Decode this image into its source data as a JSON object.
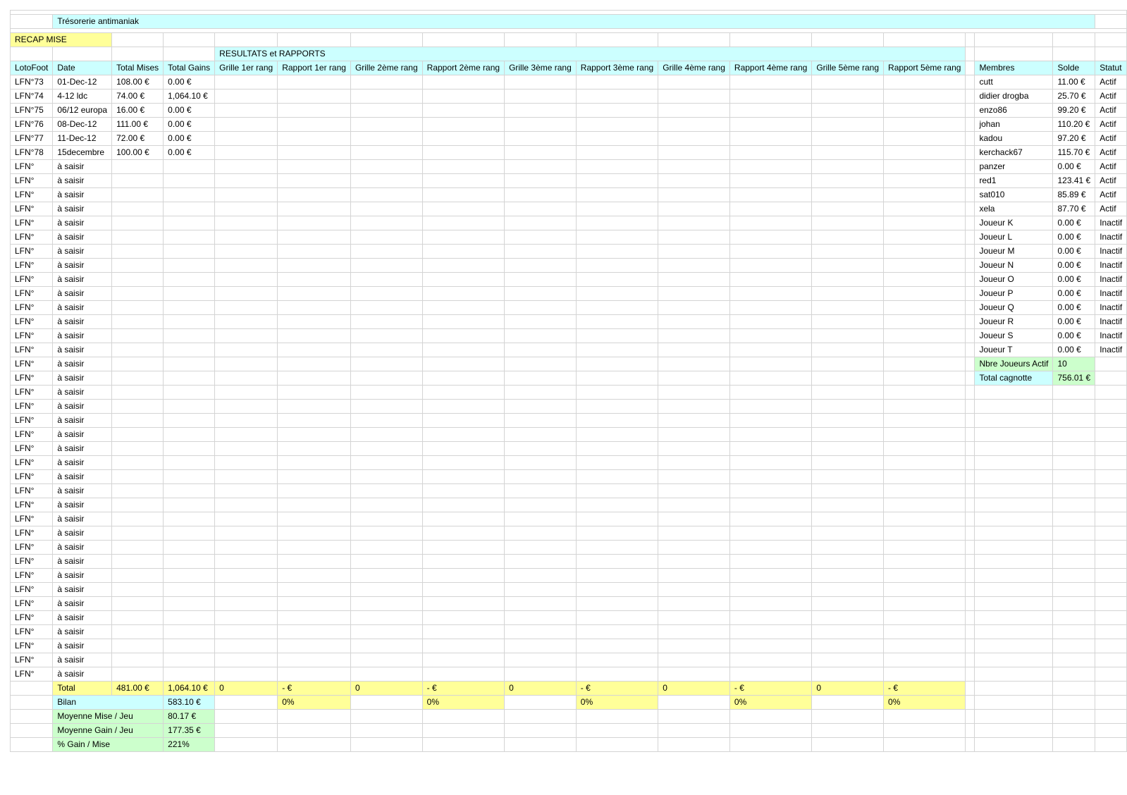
{
  "title": "Trésorerie antimaniak",
  "recap_label": "RECAP MISE",
  "results_label": "RESULTATS et RAPPORTS",
  "headers": [
    "LotoFoot",
    "Date",
    "Total Mises",
    "Total Gains",
    "Grille 1er rang",
    "Rapport 1er rang",
    "Grille 2ème rang",
    "Rapport 2ème rang",
    "Grille 3ème rang",
    "Rapport 3ème rang",
    "Grille 4ème rang",
    "Rapport 4ème rang",
    "Grille 5ème rang",
    "Rapport 5ème rang"
  ],
  "member_headers": [
    "Membres",
    "Solde",
    "Statut"
  ],
  "games": [
    {
      "id": "LFN°73",
      "date": "01-Dec-12",
      "mises": "108.00 €",
      "gains": "0.00 €"
    },
    {
      "id": "LFN°74",
      "date": "4-12 ldc",
      "mises": "74.00 €",
      "gains": "1,064.10 €"
    },
    {
      "id": "LFN°75",
      "date": "06/12 europa",
      "mises": "16.00 €",
      "gains": "0.00 €"
    },
    {
      "id": "LFN°76",
      "date": "08-Dec-12",
      "mises": "111.00 €",
      "gains": "0.00 €"
    },
    {
      "id": "LFN°77",
      "date": "11-Dec-12",
      "mises": "72.00 €",
      "gains": "0.00 €"
    },
    {
      "id": "LFN°78",
      "date": "15decembre",
      "mises": "100.00 €",
      "gains": "0.00 €"
    }
  ],
  "empty_game": {
    "id": "LFN°",
    "date": "à saisir"
  },
  "empty_game_count": 37,
  "members": [
    {
      "name": "cutt",
      "solde": "11.00 €",
      "statut": "Actif"
    },
    {
      "name": "didier drogba",
      "solde": "25.70 €",
      "statut": "Actif"
    },
    {
      "name": "enzo86",
      "solde": "99.20 €",
      "statut": "Actif"
    },
    {
      "name": "johan",
      "solde": "110.20 €",
      "statut": "Actif"
    },
    {
      "name": "kadou",
      "solde": "97.20 €",
      "statut": "Actif"
    },
    {
      "name": "kerchack67",
      "solde": "115.70 €",
      "statut": "Actif"
    },
    {
      "name": "panzer",
      "solde": "0.00 €",
      "statut": "Actif"
    },
    {
      "name": "red1",
      "solde": "123.41 €",
      "statut": "Actif"
    },
    {
      "name": "sat010",
      "solde": "85.89 €",
      "statut": "Actif"
    },
    {
      "name": "xela",
      "solde": "87.70 €",
      "statut": "Actif"
    },
    {
      "name": "Joueur K",
      "solde": "0.00 €",
      "statut": "Inactif"
    },
    {
      "name": "Joueur L",
      "solde": "0.00 €",
      "statut": "Inactif"
    },
    {
      "name": "Joueur M",
      "solde": "0.00 €",
      "statut": "Inactif"
    },
    {
      "name": "Joueur N",
      "solde": "0.00 €",
      "statut": "Inactif"
    },
    {
      "name": "Joueur O",
      "solde": "0.00 €",
      "statut": "Inactif"
    },
    {
      "name": "Joueur P",
      "solde": "0.00 €",
      "statut": "Inactif"
    },
    {
      "name": "Joueur Q",
      "solde": "0.00 €",
      "statut": "Inactif"
    },
    {
      "name": "Joueur R",
      "solde": "0.00 €",
      "statut": "Inactif"
    },
    {
      "name": "Joueur S",
      "solde": "0.00 €",
      "statut": "Inactif"
    },
    {
      "name": "Joueur T",
      "solde": "0.00 €",
      "statut": "Inactif"
    }
  ],
  "member_summary": [
    {
      "label": "Nbre Joueurs Actif",
      "value": "10"
    },
    {
      "label": "Total cagnotte",
      "value": "756.01 €"
    }
  ],
  "total_row": {
    "label": "Total",
    "mises": "481.00 €",
    "gains": "1,064.10 €",
    "rangs": [
      "0",
      "- €",
      "0",
      "- €",
      "0",
      "- €",
      "0",
      "- €",
      "0",
      "- €"
    ]
  },
  "bilan_row": {
    "label": "Bilan",
    "value": "583.10 €",
    "pcts": [
      "0%",
      "0%",
      "0%",
      "0%",
      "0%"
    ]
  },
  "stats": [
    {
      "label": "Moyenne Mise / Jeu",
      "value": "80.17 €"
    },
    {
      "label": "Moyenne Gain / Jeu",
      "value": "177.35 €"
    },
    {
      "label": "% Gain / Mise",
      "value": "221%"
    }
  ],
  "colors": {
    "header_cyan": "#ccffff",
    "highlight_yellow": "#ffff99",
    "stat_green": "#ccffcc",
    "grid": "#d4d4d4"
  }
}
